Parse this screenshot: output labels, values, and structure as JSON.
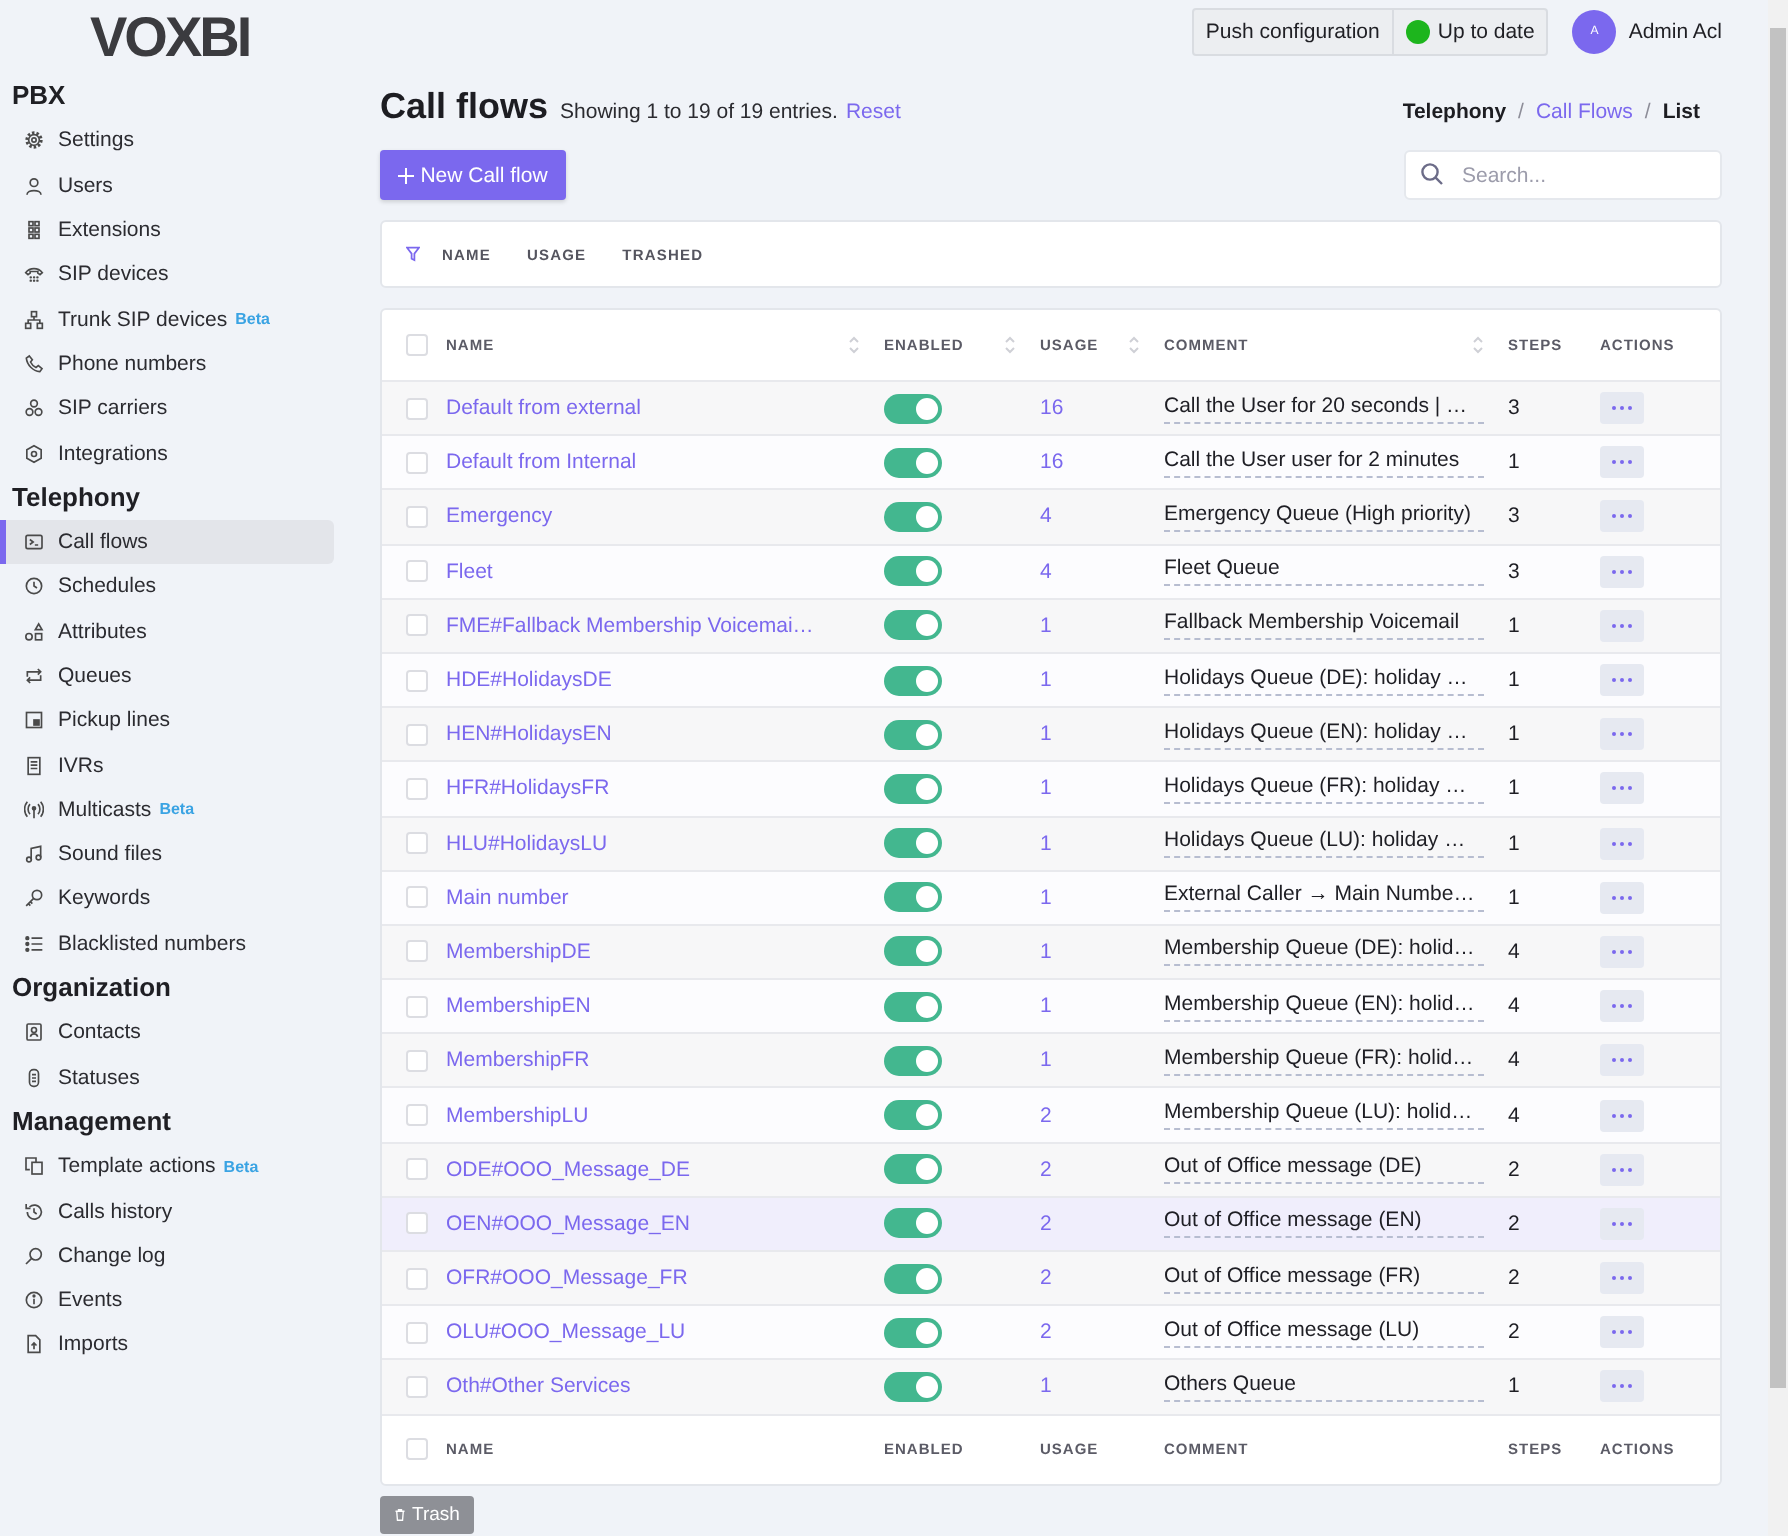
{
  "logo": "VOXBI",
  "sidebar": {
    "sections": [
      {
        "title": "PBX",
        "items": [
          {
            "label": "Settings",
            "selected": false
          },
          {
            "label": "Users",
            "selected": false
          },
          {
            "label": "Extensions",
            "selected": false
          },
          {
            "label": "SIP devices",
            "selected": false
          },
          {
            "label": "Trunk SIP devices",
            "badge": "Beta",
            "selected": false
          },
          {
            "label": "Phone numbers",
            "selected": false
          },
          {
            "label": "SIP carriers",
            "selected": false
          },
          {
            "label": "Integrations",
            "selected": false
          }
        ]
      },
      {
        "title": "Telephony",
        "items": [
          {
            "label": "Call flows",
            "selected": true
          },
          {
            "label": "Schedules",
            "selected": false
          },
          {
            "label": "Attributes",
            "selected": false
          },
          {
            "label": "Queues",
            "selected": false
          },
          {
            "label": "Pickup lines",
            "selected": false
          },
          {
            "label": "IVRs",
            "selected": false
          },
          {
            "label": "Multicasts",
            "badge": "Beta",
            "selected": false
          },
          {
            "label": "Sound files",
            "selected": false
          },
          {
            "label": "Keywords",
            "selected": false
          },
          {
            "label": "Blacklisted numbers",
            "selected": false
          }
        ]
      },
      {
        "title": "Organization",
        "items": [
          {
            "label": "Contacts",
            "selected": false
          },
          {
            "label": "Statuses",
            "selected": false
          }
        ]
      },
      {
        "title": "Management",
        "items": [
          {
            "label": "Template actions",
            "badge": "Beta",
            "selected": false
          },
          {
            "label": "Calls history",
            "selected": false
          },
          {
            "label": "Change log",
            "selected": false
          },
          {
            "label": "Events",
            "selected": false
          },
          {
            "label": "Imports",
            "selected": false
          }
        ]
      }
    ]
  },
  "topbar": {
    "push_button": "Push configuration",
    "status": {
      "label": "Up to date",
      "ok": true
    },
    "user": {
      "initial": "A",
      "name": "Admin Acl"
    }
  },
  "header": {
    "title": "Call flows",
    "summary": "Showing 1 to 19 of 19 entries.",
    "reset_link": "Reset",
    "breadcrumb": [
      {
        "kind": "text",
        "label": "Telephony"
      },
      {
        "kind": "separator",
        "label": "/"
      },
      {
        "kind": "link",
        "label": "Call Flows"
      },
      {
        "kind": "separator",
        "label": "/"
      },
      {
        "kind": "text",
        "label": "List"
      }
    ]
  },
  "new_button": {
    "label": "New Call flow"
  },
  "search": {
    "placeholder": "Search..."
  },
  "filters": [
    "NAME",
    "USAGE",
    "TRASHED"
  ],
  "table": {
    "header_select": {
      "checked": false
    },
    "columns": [
      {
        "label": "NAME",
        "sortable": true
      },
      {
        "label": "ENABLED",
        "sortable": true
      },
      {
        "label": "USAGE",
        "sortable": true
      },
      {
        "label": "COMMENT",
        "sortable": true
      },
      {
        "label": "STEPS",
        "sortable": false
      },
      {
        "label": "ACTIONS",
        "sortable": false
      }
    ],
    "rows": [
      {
        "checked": false,
        "name": "Default from external",
        "enabled": true,
        "usage": "16",
        "comment": "Call the User for 20 seconds | …",
        "steps": "3",
        "hovered": false
      },
      {
        "checked": false,
        "name": "Default from Internal",
        "enabled": true,
        "usage": "16",
        "comment": "Call the User user for 2 minutes",
        "steps": "1",
        "hovered": false
      },
      {
        "checked": false,
        "name": "Emergency",
        "enabled": true,
        "usage": "4",
        "comment": "Emergency Queue (High priority)",
        "steps": "3",
        "hovered": false
      },
      {
        "checked": false,
        "name": "Fleet",
        "enabled": true,
        "usage": "4",
        "comment": "Fleet Queue",
        "steps": "3",
        "hovered": false
      },
      {
        "checked": false,
        "name": "FME#Fallback Membership Voicemai…",
        "enabled": true,
        "usage": "1",
        "comment": "Fallback Membership Voicemail",
        "steps": "1",
        "hovered": false
      },
      {
        "checked": false,
        "name": "HDE#HolidaysDE",
        "enabled": true,
        "usage": "1",
        "comment": "Holidays Queue (DE): holiday …",
        "steps": "1",
        "hovered": false
      },
      {
        "checked": false,
        "name": "HEN#HolidaysEN",
        "enabled": true,
        "usage": "1",
        "comment": "Holidays Queue (EN): holiday …",
        "steps": "1",
        "hovered": false
      },
      {
        "checked": false,
        "name": "HFR#HolidaysFR",
        "enabled": true,
        "usage": "1",
        "comment": "Holidays Queue (FR): holiday …",
        "steps": "1",
        "hovered": false
      },
      {
        "checked": false,
        "name": "HLU#HolidaysLU",
        "enabled": true,
        "usage": "1",
        "comment": "Holidays Queue (LU): holiday …",
        "steps": "1",
        "hovered": false
      },
      {
        "checked": false,
        "name": "Main number",
        "enabled": true,
        "usage": "1",
        "comment": "External Caller → Main Numbe…",
        "steps": "1",
        "hovered": false
      },
      {
        "checked": false,
        "name": "MembershipDE",
        "enabled": true,
        "usage": "1",
        "comment": "Membership Queue (DE): holid…",
        "steps": "4",
        "hovered": false
      },
      {
        "checked": false,
        "name": "MembershipEN",
        "enabled": true,
        "usage": "1",
        "comment": "Membership Queue (EN): holid…",
        "steps": "4",
        "hovered": false
      },
      {
        "checked": false,
        "name": "MembershipFR",
        "enabled": true,
        "usage": "1",
        "comment": "Membership Queue (FR): holid…",
        "steps": "4",
        "hovered": false
      },
      {
        "checked": false,
        "name": "MembershipLU",
        "enabled": true,
        "usage": "2",
        "comment": "Membership Queue (LU): holid…",
        "steps": "4",
        "hovered": false
      },
      {
        "checked": false,
        "name": "ODE#OOO_Message_DE",
        "enabled": true,
        "usage": "2",
        "comment": "Out of Office message (DE)",
        "steps": "2",
        "hovered": false
      },
      {
        "checked": false,
        "name": "OEN#OOO_Message_EN",
        "enabled": true,
        "usage": "2",
        "comment": "Out of Office message (EN)",
        "steps": "2",
        "hovered": true
      },
      {
        "checked": false,
        "name": "OFR#OOO_Message_FR",
        "enabled": true,
        "usage": "2",
        "comment": "Out of Office message (FR)",
        "steps": "2",
        "hovered": false
      },
      {
        "checked": false,
        "name": "OLU#OOO_Message_LU",
        "enabled": true,
        "usage": "2",
        "comment": "Out of Office message (LU)",
        "steps": "2",
        "hovered": false
      },
      {
        "checked": false,
        "name": "Oth#Other Services",
        "enabled": true,
        "usage": "1",
        "comment": "Others Queue",
        "steps": "1",
        "hovered": false
      }
    ],
    "footer_select": {
      "checked": false
    },
    "footer_columns": [
      "NAME",
      "ENABLED",
      "USAGE",
      "COMMENT",
      "STEPS",
      "ACTIONS"
    ]
  },
  "trash_button": {
    "label": "Trash",
    "disabled": true
  }
}
